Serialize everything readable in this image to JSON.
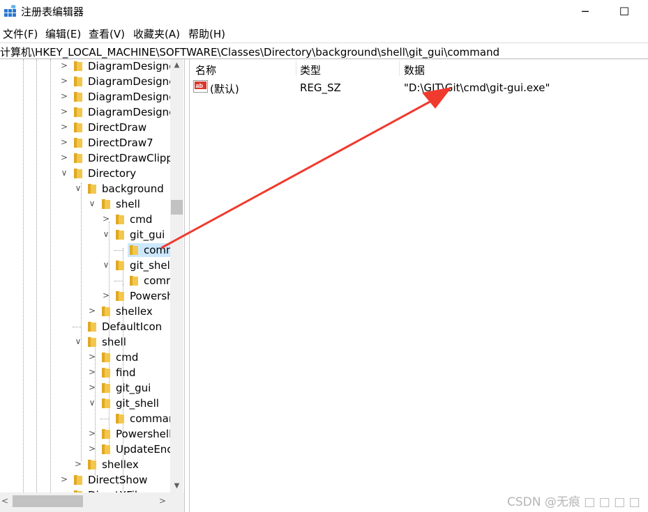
{
  "window": {
    "title": "注册表编辑器",
    "minimize_glyph": "─",
    "maximize_glyph": "☐",
    "icon": "regedit-icon"
  },
  "menu": [
    "文件(F)",
    "编辑(E)",
    "查看(V)",
    "收藏夹(A)",
    "帮助(H)"
  ],
  "address": "计算机\\HKEY_LOCAL_MACHINE\\SOFTWARE\\Classes\\Directory\\background\\shell\\git_gui\\command",
  "tree": [
    {
      "label": "DiagramDesigne",
      "toggle": ">"
    },
    {
      "label": "DiagramDesigne",
      "toggle": ">"
    },
    {
      "label": "DiagramDesigne",
      "toggle": ">"
    },
    {
      "label": "DiagramDesigne",
      "toggle": ">"
    },
    {
      "label": "DirectDraw",
      "toggle": ">"
    },
    {
      "label": "DirectDraw7",
      "toggle": ">"
    },
    {
      "label": "DirectDrawClipp",
      "toggle": ">"
    },
    {
      "label": "Directory",
      "toggle": "v"
    },
    {
      "label": "background",
      "toggle": "v"
    },
    {
      "label": "shell",
      "toggle": "v"
    },
    {
      "label": "cmd",
      "toggle": ">"
    },
    {
      "label": "git_gui",
      "toggle": "v"
    },
    {
      "label": "comm",
      "toggle": "",
      "selected": true
    },
    {
      "label": "git_shel",
      "toggle": "v"
    },
    {
      "label": "comr",
      "toggle": ""
    },
    {
      "label": "Powersh",
      "toggle": ">"
    },
    {
      "label": "shellex",
      "toggle": ">"
    },
    {
      "label": "DefaultIcon",
      "toggle": ""
    },
    {
      "label": "shell",
      "toggle": "v"
    },
    {
      "label": "cmd",
      "toggle": ">"
    },
    {
      "label": "find",
      "toggle": ">"
    },
    {
      "label": "git_gui",
      "toggle": ">"
    },
    {
      "label": "git_shell",
      "toggle": "v"
    },
    {
      "label": "commar",
      "toggle": ""
    },
    {
      "label": "Powershell",
      "toggle": ">"
    },
    {
      "label": "UpdateEnc",
      "toggle": ">"
    },
    {
      "label": "shellex",
      "toggle": ">"
    },
    {
      "label": "DirectShow",
      "toggle": ">"
    },
    {
      "label": "DirectXFil",
      "toggle": ">"
    }
  ],
  "list": {
    "headers": {
      "name": "名称",
      "type": "类型",
      "data": "数据"
    },
    "rows": [
      {
        "name": "(默认)",
        "type": "REG_SZ",
        "data": "\"D:\\GIT\\Git\\cmd\\git-gui.exe\"",
        "icon": "string-value-icon"
      }
    ]
  },
  "scrollbars": {
    "up": "▲",
    "down": "▼",
    "left": "<",
    "right": ">"
  },
  "watermark": "CSDN @无痕 □ □ □ □",
  "annotation": {
    "color": "#f03a2e"
  },
  "colors": {
    "selection": "#cce8ff",
    "folder": "#f3c74c"
  }
}
